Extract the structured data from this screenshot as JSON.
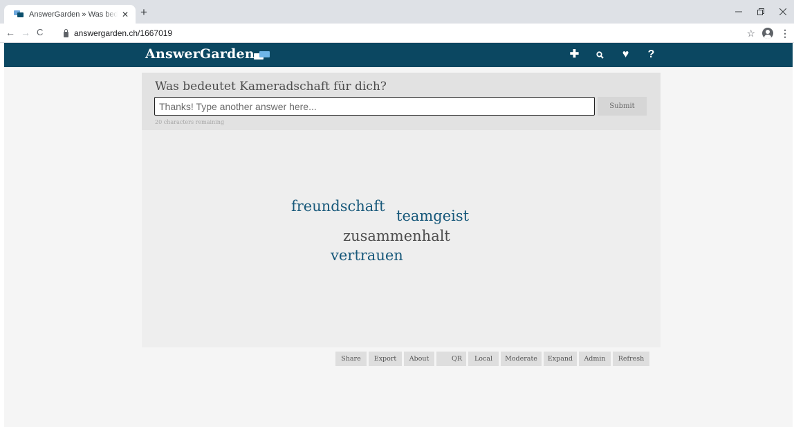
{
  "browser": {
    "tab_title": "AnswerGarden » Was bedeutet K",
    "tab_close": "✕",
    "new_tab": "+",
    "url": "answergarden.ch/1667019",
    "nav": {
      "back": "←",
      "forward": "→",
      "reload": "C"
    },
    "star": "☆",
    "menu": "⋮"
  },
  "app": {
    "brand": "AnswerGarden",
    "accent_color": "#0b4761",
    "top_icons": [
      {
        "name": "plus-icon",
        "glyph": "✚"
      },
      {
        "name": "search-icon",
        "glyph": "🔍"
      },
      {
        "name": "heart-icon",
        "glyph": "♥"
      },
      {
        "name": "help-icon",
        "glyph": "?"
      }
    ]
  },
  "question": {
    "title": "Was bedeutet Kameradschaft für dich?",
    "input_placeholder": "Thanks! Type another answer here...",
    "input_value": "",
    "submit_label": "Submit",
    "remaining_text": "20 characters remaining"
  },
  "cloud": {
    "words": [
      {
        "text": "freundschaft",
        "color": "#17587a"
      },
      {
        "text": "teamgeist",
        "color": "#17587a"
      },
      {
        "text": "zusammenhalt",
        "color": "#4e4e4e"
      },
      {
        "text": "vertrauen",
        "color": "#17587a"
      }
    ]
  },
  "footer": {
    "buttons": [
      "Share",
      "Export",
      "About",
      "QR",
      "Local",
      "Moderate",
      "Expand",
      "Admin",
      "Refresh"
    ]
  }
}
